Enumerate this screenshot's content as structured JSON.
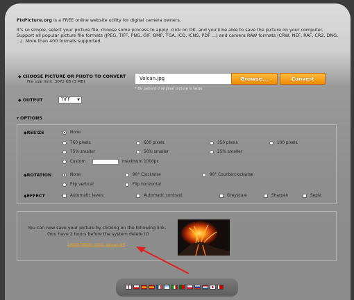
{
  "intro": {
    "site_name": "FixPicture.org",
    "line1_rest": " is a FREE online website utility for digital camera owners.",
    "paragraph2": "It's so simple, select your picture file, choose some process to apply, click on OK, and you'll be able to save the picture on your computer.",
    "paragraph3": "Support all popular picture file formats (JPEG, TIFF, PNG, GIF, BMP, TGA, ICO, ICNS, PDF ...) and camera RAW formats (CRW, NEF, RAF, CR2, DNG, ...). More than 400 formats supported."
  },
  "upload": {
    "label": "CHOOSE PICTURE OR PHOTO TO CONVERT",
    "size_limit": "File size limit: 3072 KB (3 MB)",
    "file_value": "Volcán.jpg",
    "browse_label": "Browse...",
    "convert_label": "Convert",
    "hint": "* Be patient if original picture is large"
  },
  "output": {
    "label": "OUTPUT",
    "selected": "TIFF"
  },
  "options": {
    "label": "OPTIONS",
    "resize": {
      "label": "RESIZE",
      "none": "None",
      "p760": "760 pixels",
      "p600": "600 pixels",
      "p350": "350 pixels",
      "p100": "100 pixels",
      "s75": "75% smaller",
      "s50": "50% smaller",
      "s25": "25% smaller",
      "custom": "Custom",
      "custom_max": "maximum 1000px"
    },
    "rotation": {
      "label": "ROTATION",
      "none": "None",
      "cw": "90° Clockwise",
      "ccw": "90° Counterclockwise",
      "flip_v": "Flip vertical",
      "flip_h": "Flip horizontal"
    },
    "effect": {
      "label": "EFFECT",
      "auto_levels": "Automatic levels",
      "auto_contrast": "Automatic contrast",
      "greyscale": "Greyscale",
      "sharpen": "Sharpen",
      "sepia": "Sepia"
    }
  },
  "result": {
    "message1": "You can now save your picture by clicking on the following link.",
    "message2": "(You have 2 hours before the system delete it)",
    "download_link": "1400578000_0001_Volcan.tiff"
  },
  "colors": {
    "accent_orange": "#f49a1a",
    "link_orange": "#f0a020",
    "arrow_red": "#e02020"
  }
}
